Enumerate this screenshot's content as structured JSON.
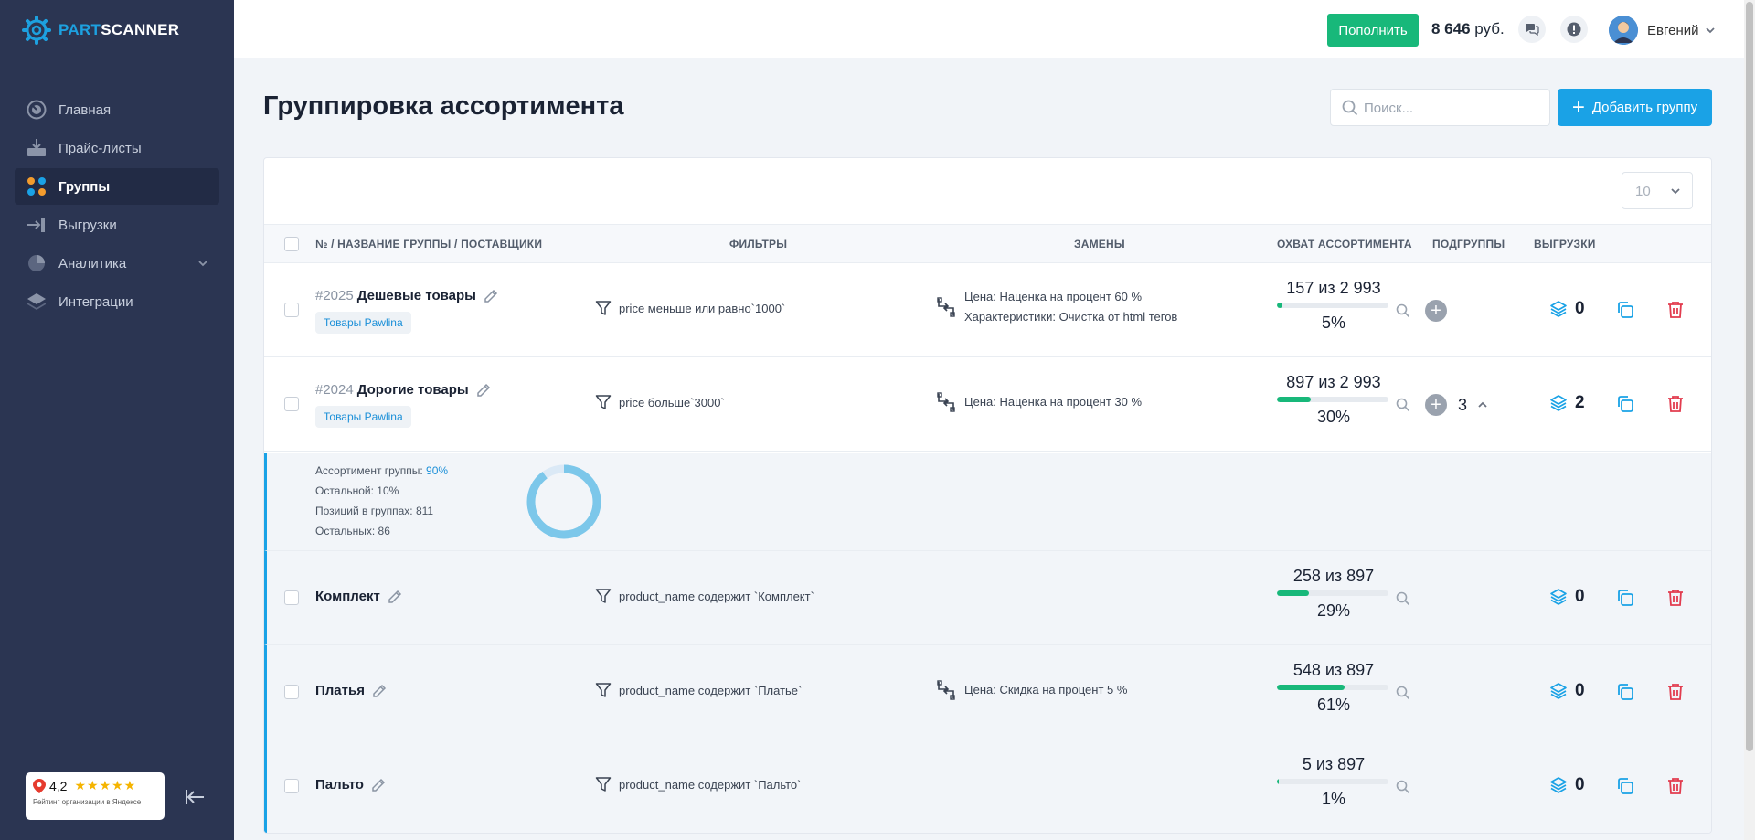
{
  "app": {
    "brand_part1": "PART",
    "brand_part2": "SCANNER"
  },
  "sidebar": {
    "items": [
      {
        "label": "Главная",
        "icon": "dashboard-icon"
      },
      {
        "label": "Прайс-листы",
        "icon": "inbox-download-icon"
      },
      {
        "label": "Группы",
        "icon": "groups-dots-icon",
        "active": true
      },
      {
        "label": "Выгрузки",
        "icon": "export-arrow-icon"
      },
      {
        "label": "Аналитика",
        "icon": "pie-chart-icon",
        "has_children": true
      },
      {
        "label": "Интеграции",
        "icon": "layers-icon"
      }
    ],
    "rating": {
      "value": "4,2",
      "stars": "★★★★★",
      "caption": "Рейтинг организации в Яндексе"
    }
  },
  "topbar": {
    "topup_label": "Пополнить",
    "balance_amount": "8 646",
    "balance_currency": "руб.",
    "user_name": "Евгений"
  },
  "page": {
    "title": "Группировка ассортимента",
    "search_placeholder": "Поиск...",
    "add_group_label": "Добавить группу",
    "per_page": "10"
  },
  "table": {
    "headers": {
      "name": "№ / НАЗВАНИЕ ГРУППЫ / ПОСТАВЩИКИ",
      "filters": "ФИЛЬТРЫ",
      "replacements": "ЗАМЕНЫ",
      "coverage": "ОХВАТ АССОРТИМЕНТА",
      "subgroups": "ПОДГРУППЫ",
      "exports": "ВЫГРУЗКИ"
    },
    "rows": [
      {
        "number": "#2025",
        "name": "Дешевые товары",
        "supplier": "Товары Pawlina",
        "filter": "price меньше или равно`1000`",
        "replacements": [
          "Цена: Наценка на процент 60 %",
          "Характеристики: Очистка от html тегов"
        ],
        "coverage": "157 из 2 993",
        "coverage_fraction": 0.05,
        "coverage_pct": "5%",
        "subgroups": "",
        "exports": "0"
      },
      {
        "number": "#2024",
        "name": "Дорогие товары",
        "supplier": "Товары Pawlina",
        "filter": "price больше`3000`",
        "replacements": [
          "Цена: Наценка на процент 30 %"
        ],
        "coverage": "897 из 2 993",
        "coverage_fraction": 0.3,
        "coverage_pct": "30%",
        "subgroups": "3",
        "exports": "2"
      }
    ],
    "expanded": {
      "assortment_label": "Ассортимент группы:",
      "assortment_value": "90%",
      "assortment_fraction": 0.9,
      "other": "Остальной: 10%",
      "positions": "Позиций в группах: 811",
      "others": "Остальных: 86"
    },
    "subrows": [
      {
        "name": "Комплект",
        "filter": "product_name содержит `Комплект`",
        "replacements": [],
        "coverage": "258 из 897",
        "coverage_fraction": 0.29,
        "coverage_pct": "29%",
        "exports": "0"
      },
      {
        "name": "Платья",
        "filter": "product_name содержит `Платье`",
        "replacements": [
          "Цена: Скидка на процент 5 %"
        ],
        "coverage": "548 из 897",
        "coverage_fraction": 0.61,
        "coverage_pct": "61%",
        "exports": "0"
      },
      {
        "name": "Пальто",
        "filter": "product_name содержит `Пальто`",
        "replacements": [],
        "coverage": "5 из 897",
        "coverage_fraction": 0.01,
        "coverage_pct": "1%",
        "exports": "0"
      }
    ]
  },
  "colors": {
    "sidebar_bg": "#2b3552",
    "accent_blue": "#1aa2e6",
    "accent_green": "#18b87a",
    "delete_red": "#e23c4f"
  }
}
